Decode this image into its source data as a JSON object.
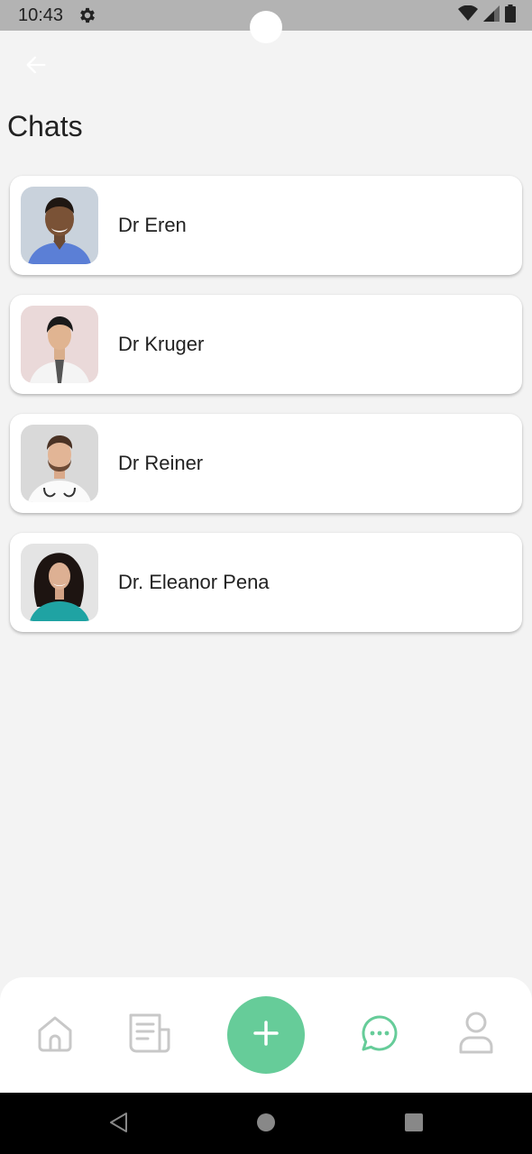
{
  "status_bar": {
    "time": "10:43",
    "icons": [
      "gear-icon",
      "wifi-icon",
      "signal-icon",
      "battery-icon"
    ]
  },
  "header": {
    "back_icon": "arrow-left-icon",
    "title": "Chats"
  },
  "chats": [
    {
      "name": "Dr Eren",
      "avatar": "doctor-photo"
    },
    {
      "name": "Dr Kruger",
      "avatar": "doctor-photo"
    },
    {
      "name": "Dr Reiner",
      "avatar": "doctor-photo"
    },
    {
      "name": "Dr. Eleanor Pena",
      "avatar": "doctor-photo"
    }
  ],
  "bottom_nav": {
    "items": [
      "home-icon",
      "news-icon",
      "add-icon",
      "chat-icon",
      "profile-icon"
    ],
    "active": "chat-icon"
  },
  "colors": {
    "accent": "#66cc99",
    "inactive_icon": "#c8c8c8",
    "background": "#f3f3f3",
    "card": "#ffffff",
    "status_bar": "#b3b3b3"
  },
  "system_nav": [
    "back-triangle-icon",
    "home-circle-icon",
    "recents-square-icon"
  ]
}
